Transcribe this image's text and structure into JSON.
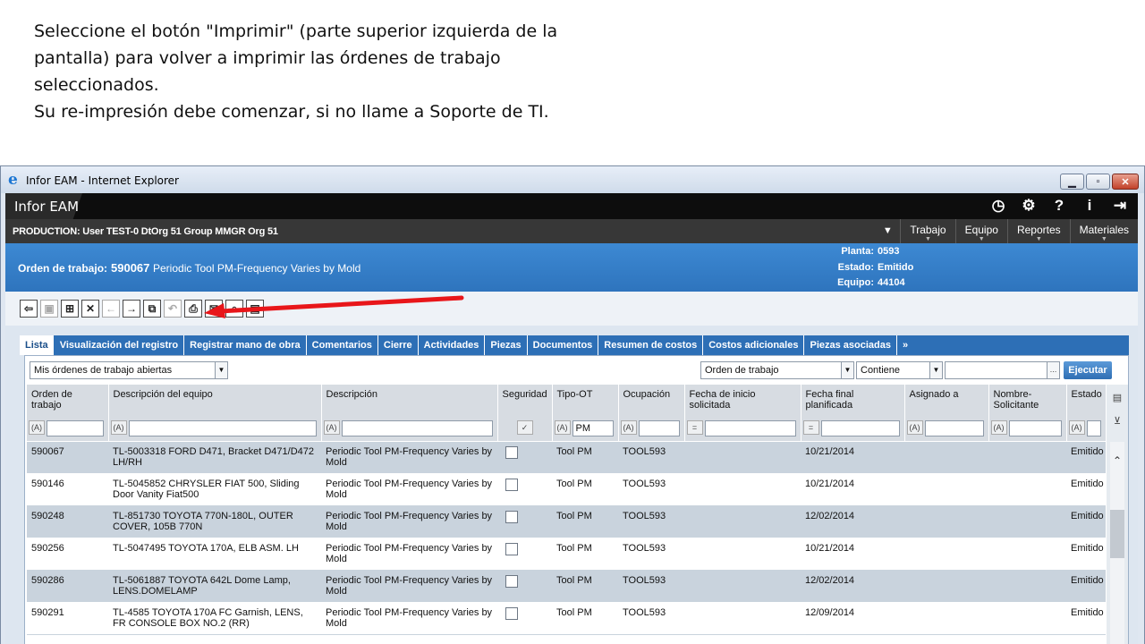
{
  "instructions": [
    "Seleccione el botón \"Imprimir\" (parte superior izquierda de la",
    "pantalla) para volver a imprimir las órdenes de trabajo",
    "seleccionados.",
    "Su re-impresión debe comenzar, si no llame a Soporte de TI."
  ],
  "window": {
    "title": "Infor EAM - Internet Explorer",
    "buttons": [
      "minimize-icon",
      "maximize-icon",
      "close-icon"
    ]
  },
  "app": {
    "name": "Infor EAM",
    "icons": [
      "clock-icon",
      "gear-icon",
      "help-icon",
      "info-icon",
      "logout-icon"
    ]
  },
  "userbar": {
    "info": "PRODUCTION: User TEST-0 DtOrg 51 Group MMGR Org 51",
    "menus": [
      "Trabajo",
      "Equipo",
      "Reportes",
      "Materiales"
    ]
  },
  "record": {
    "label": "Orden de trabajo:",
    "number": "590067",
    "description": "Periodic Tool PM-Frequency Varies by Mold",
    "planta_label": "Planta:",
    "planta": "0593",
    "estado_label": "Estado:",
    "estado": "Emitido",
    "equipo_label": "Equipo:",
    "equipo": "44104"
  },
  "toolbar": {
    "buttons": [
      "back-icon",
      "save-icon",
      "new-record-icon",
      "delete-icon",
      "previous-icon",
      "next-icon",
      "copy-icon",
      "undo-icon",
      "print-icon",
      "email-icon",
      "lock-icon",
      "layout-icon"
    ],
    "highlight_color": "#e8161a"
  },
  "tabs": [
    "Lista",
    "Visualización del registro",
    "Registrar mano de obra",
    "Comentarios",
    "Cierre",
    "Actividades",
    "Piezas",
    "Documentos",
    "Resumen de costos",
    "Costos adicionales",
    "Piezas asociadas",
    "»"
  ],
  "filter": {
    "dataspy": "Mis órdenes de trabajo abiertas",
    "field": "Orden de trabajo",
    "operator": "Contiene",
    "value": "",
    "run_label": "Ejecutar"
  },
  "grid": {
    "columns": [
      "Orden de trabajo",
      "Descripción del equipo",
      "Descripción",
      "Seguridad",
      "Tipo-OT",
      "Ocupación",
      "Fecha de inicio solicitada",
      "Fecha final planificada",
      "Asignado a",
      "Nombre-Solicitante",
      "Estado"
    ],
    "filter_modes": [
      "(A)",
      "(A)",
      "(A)",
      "✓",
      "(A)",
      "(A)",
      "=",
      "=",
      "(A)",
      "(A)",
      "(A)"
    ],
    "filter_values": [
      "",
      "",
      "",
      "",
      "PM",
      "",
      "",
      "",
      "",
      "",
      ""
    ],
    "rows": [
      [
        "590067",
        "TL-5003318 FORD D471, Bracket D471/D472 LH/RH",
        "Periodic Tool PM-Frequency Varies by Mold",
        "",
        "Tool PM",
        "TOOL593",
        "",
        "10/21/2014",
        "",
        "",
        "Emitido"
      ],
      [
        "590146",
        "TL-5045852 CHRYSLER FIAT 500, Sliding Door Vanity Fiat500",
        "Periodic Tool PM-Frequency Varies by Mold",
        "",
        "Tool PM",
        "TOOL593",
        "",
        "10/21/2014",
        "",
        "",
        "Emitido"
      ],
      [
        "590248",
        "TL-851730 TOYOTA 770N-180L, OUTER COVER, 105B 770N",
        "Periodic Tool PM-Frequency Varies by Mold",
        "",
        "Tool PM",
        "TOOL593",
        "",
        "12/02/2014",
        "",
        "",
        "Emitido"
      ],
      [
        "590256",
        "TL-5047495 TOYOTA 170A, ELB ASM. LH",
        "Periodic Tool PM-Frequency Varies by Mold",
        "",
        "Tool PM",
        "TOOL593",
        "",
        "10/21/2014",
        "",
        "",
        "Emitido"
      ],
      [
        "590286",
        "TL-5061887 TOYOTA 642L Dome Lamp, LENS.DOMELAMP",
        "Periodic Tool PM-Frequency Varies by Mold",
        "",
        "Tool PM",
        "TOOL593",
        "",
        "12/02/2014",
        "",
        "",
        "Emitido"
      ],
      [
        "590291",
        "TL-4585 TOYOTA 170A FC Garnish, LENS, FR CONSOLE BOX NO.2 (RR)",
        "Periodic Tool PM-Frequency Varies by Mold",
        "",
        "Tool PM",
        "TOOL593",
        "",
        "12/09/2014",
        "",
        "",
        "Emitido"
      ]
    ]
  }
}
